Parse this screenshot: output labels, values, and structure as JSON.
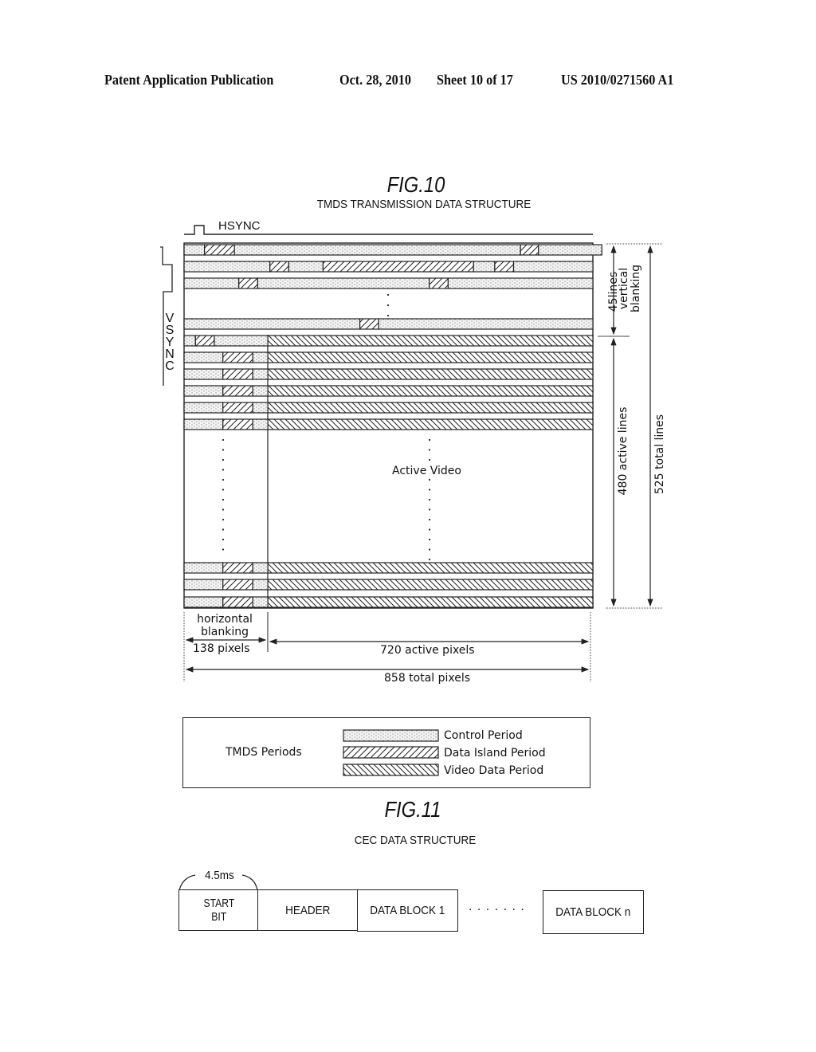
{
  "header": {
    "publication": "Patent Application Publication",
    "date": "Oct. 28, 2010",
    "sheet": "Sheet 10 of 17",
    "patent_number": "US 2010/0271560 A1"
  },
  "fig10": {
    "title": "FIG.10",
    "subtitle": "TMDS TRANSMISSION DATA STRUCTURE",
    "hsync_label": "HSYNC",
    "vsync_label": [
      "V",
      "S",
      "Y",
      "N",
      "C"
    ],
    "active_video_label": "Active Video",
    "vertical_blanking_lines": "45lines",
    "vertical_blanking_label_1": "vertical",
    "vertical_blanking_label_2": "blanking",
    "active_lines": "480 active lines",
    "total_lines": "525 total lines",
    "horizontal_blanking_label_1": "horizontal",
    "horizontal_blanking_label_2": "blanking",
    "blanking_pixels": "138 pixels",
    "active_pixels": "720 active pixels",
    "total_pixels": "858 total pixels",
    "values": {
      "total_pixels": 858,
      "blanking_pixels": 138,
      "active_pixels": 720,
      "total_lines": 525,
      "active_lines": 480,
      "blanking_lines": 45
    },
    "blanking_rows": [
      [
        [
          "c",
          0.05
        ],
        [
          "d",
          0.073
        ],
        [
          "c",
          0.7
        ],
        [
          "d",
          0.044
        ],
        [
          "c",
          0.155
        ]
      ],
      [
        [
          "c",
          0.21
        ],
        [
          "d",
          0.046
        ],
        [
          "c",
          0.084
        ],
        [
          "d",
          0.368
        ],
        [
          "c",
          0.052
        ],
        [
          "d",
          0.046
        ],
        [
          "c",
          0.194
        ]
      ],
      [
        [
          "c",
          0.134
        ],
        [
          "d",
          0.046
        ],
        [
          "c",
          0.42
        ],
        [
          "d",
          0.046
        ],
        [
          "c",
          0.354
        ]
      ],
      [
        [
          "c",
          0.43
        ],
        [
          "d",
          0.046
        ],
        [
          "c",
          0.524
        ]
      ],
      [
        [
          "c",
          0.028
        ],
        [
          "d",
          0.046
        ],
        [
          "c",
          0.131
        ],
        [
          "v",
          0.795
        ]
      ]
    ],
    "active_row_pattern": [
      [
        "c",
        0.095
      ],
      [
        "d",
        0.073
      ],
      [
        "c",
        0.037
      ],
      [
        "v",
        0.795
      ]
    ]
  },
  "legend": {
    "title": "TMDS Periods",
    "items": [
      {
        "pattern": "control",
        "label": "Control Period"
      },
      {
        "pattern": "data-island",
        "label": "Data Island Period"
      },
      {
        "pattern": "video-data",
        "label": "Video Data Period"
      }
    ]
  },
  "fig11": {
    "title": "FIG.11",
    "subtitle": "CEC DATA STRUCTURE",
    "start_bit_duration": "4.5ms",
    "blocks": [
      "START\nBIT",
      "HEADER",
      "DATA BLOCK 1",
      "DATA BLOCK n"
    ],
    "start_bit_line1": "START",
    "start_bit_line2": "BIT",
    "ellipsis": "· · · · · · ·"
  }
}
